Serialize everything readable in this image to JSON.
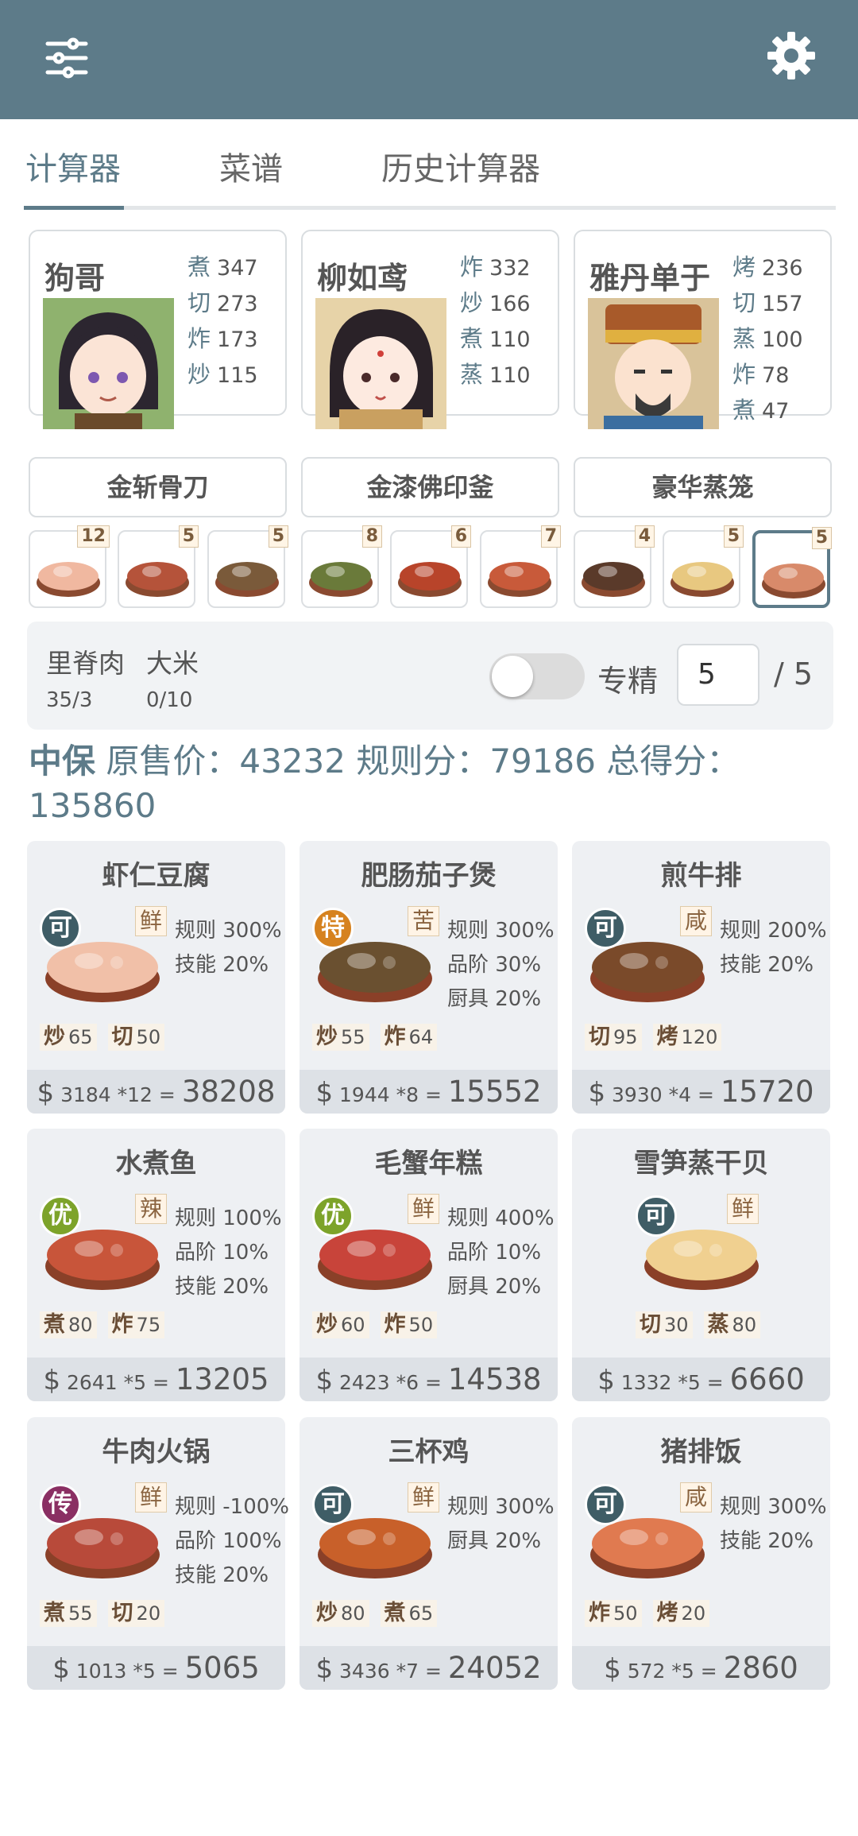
{
  "tabs": [
    "计算器",
    "菜谱",
    "历史计算器"
  ],
  "icons": {
    "menu": "sliders-icon",
    "settings": "gear-icon"
  },
  "colors": {
    "primary": "#5d7b89",
    "grade_ke": "#3f5d66",
    "grade_te": "#d6821f",
    "grade_you": "#7da32a",
    "grade_chuan": "#8a2f63"
  },
  "chefs": [
    {
      "name": "狗哥",
      "skills": [
        {
          "k": "煮",
          "v": "347"
        },
        {
          "k": "切",
          "v": "273"
        },
        {
          "k": "炸",
          "v": "173"
        },
        {
          "k": "炒",
          "v": "115"
        }
      ]
    },
    {
      "name": "柳如鸢",
      "skills": [
        {
          "k": "炸",
          "v": "332"
        },
        {
          "k": "炒",
          "v": "166"
        },
        {
          "k": "煮",
          "v": "110"
        },
        {
          "k": "蒸",
          "v": "110"
        }
      ]
    },
    {
      "name": "雅丹单于",
      "skills": [
        {
          "k": "烤",
          "v": "236"
        },
        {
          "k": "切",
          "v": "157"
        },
        {
          "k": "蒸",
          "v": "100"
        },
        {
          "k": "炸",
          "v": "78"
        },
        {
          "k": "煮",
          "v": "47"
        }
      ]
    }
  ],
  "tools": [
    "金斩骨刀",
    "金漆佛印釜",
    "豪华蒸笼"
  ],
  "dish_counts": [
    "12",
    "5",
    "5",
    "8",
    "6",
    "7",
    "4",
    "5",
    "5"
  ],
  "ingredients": [
    {
      "name": "里脊肉",
      "value": "35/3"
    },
    {
      "name": "大米",
      "value": "0/10"
    }
  ],
  "specialty": {
    "label": "专精",
    "value": "5",
    "max": "/ 5",
    "enabled": false
  },
  "summary": {
    "strong": "中保",
    "text": " 原售价：43232 规则分：79186 总得分：135860"
  },
  "dishes": [
    {
      "name": "虾仁豆腐",
      "grade": "可",
      "flavor": "鲜",
      "rules": [
        "规则 300%",
        "技能 20%"
      ],
      "reqs": [
        {
          "k": "炒",
          "v": "65"
        },
        {
          "k": "切",
          "v": "50"
        }
      ],
      "price": "3184 *12",
      "total": "38208"
    },
    {
      "name": "肥肠茄子煲",
      "grade": "特",
      "flavor": "苦",
      "rules": [
        "规则 300%",
        "品阶 30%",
        "厨具 20%"
      ],
      "reqs": [
        {
          "k": "炒",
          "v": "55"
        },
        {
          "k": "炸",
          "v": "64"
        }
      ],
      "price": "1944 *8",
      "total": "15552"
    },
    {
      "name": "煎牛排",
      "grade": "可",
      "flavor": "咸",
      "rules": [
        "规则 200%",
        "技能 20%"
      ],
      "reqs": [
        {
          "k": "切",
          "v": "95"
        },
        {
          "k": "烤",
          "v": "120"
        }
      ],
      "price": "3930 *4",
      "total": "15720"
    },
    {
      "name": "水煮鱼",
      "grade": "优",
      "flavor": "辣",
      "rules": [
        "规则 100%",
        "品阶 10%",
        "技能 20%"
      ],
      "reqs": [
        {
          "k": "煮",
          "v": "80"
        },
        {
          "k": "炸",
          "v": "75"
        }
      ],
      "price": "2641 *5",
      "total": "13205"
    },
    {
      "name": "毛蟹年糕",
      "grade": "优",
      "flavor": "鲜",
      "rules": [
        "规则 400%",
        "品阶 10%",
        "厨具 20%"
      ],
      "reqs": [
        {
          "k": "炒",
          "v": "60"
        },
        {
          "k": "炸",
          "v": "50"
        }
      ],
      "price": "2423 *6",
      "total": "14538"
    },
    {
      "name": "雪笋蒸干贝",
      "grade": "可",
      "flavor": "鲜",
      "rules": [],
      "reqs": [
        {
          "k": "切",
          "v": "30"
        },
        {
          "k": "蒸",
          "v": "80"
        }
      ],
      "price": "1332 *5",
      "total": "6660"
    },
    {
      "name": "牛肉火锅",
      "grade": "传",
      "flavor": "鲜",
      "rules": [
        "规则 -100%",
        "品阶 100%",
        "技能 20%"
      ],
      "reqs": [
        {
          "k": "煮",
          "v": "55"
        },
        {
          "k": "切",
          "v": "20"
        }
      ],
      "price": "1013 *5",
      "total": "5065"
    },
    {
      "name": "三杯鸡",
      "grade": "可",
      "flavor": "鲜",
      "rules": [
        "规则 300%",
        "厨具 20%"
      ],
      "reqs": [
        {
          "k": "炒",
          "v": "80"
        },
        {
          "k": "煮",
          "v": "65"
        }
      ],
      "price": "3436 *7",
      "total": "24052"
    },
    {
      "name": "猪排饭",
      "grade": "可",
      "flavor": "咸",
      "rules": [
        "规则 300%",
        "技能 20%"
      ],
      "reqs": [
        {
          "k": "炸",
          "v": "50"
        },
        {
          "k": "烤",
          "v": "20"
        }
      ],
      "price": "572 *5",
      "total": "2860"
    }
  ]
}
